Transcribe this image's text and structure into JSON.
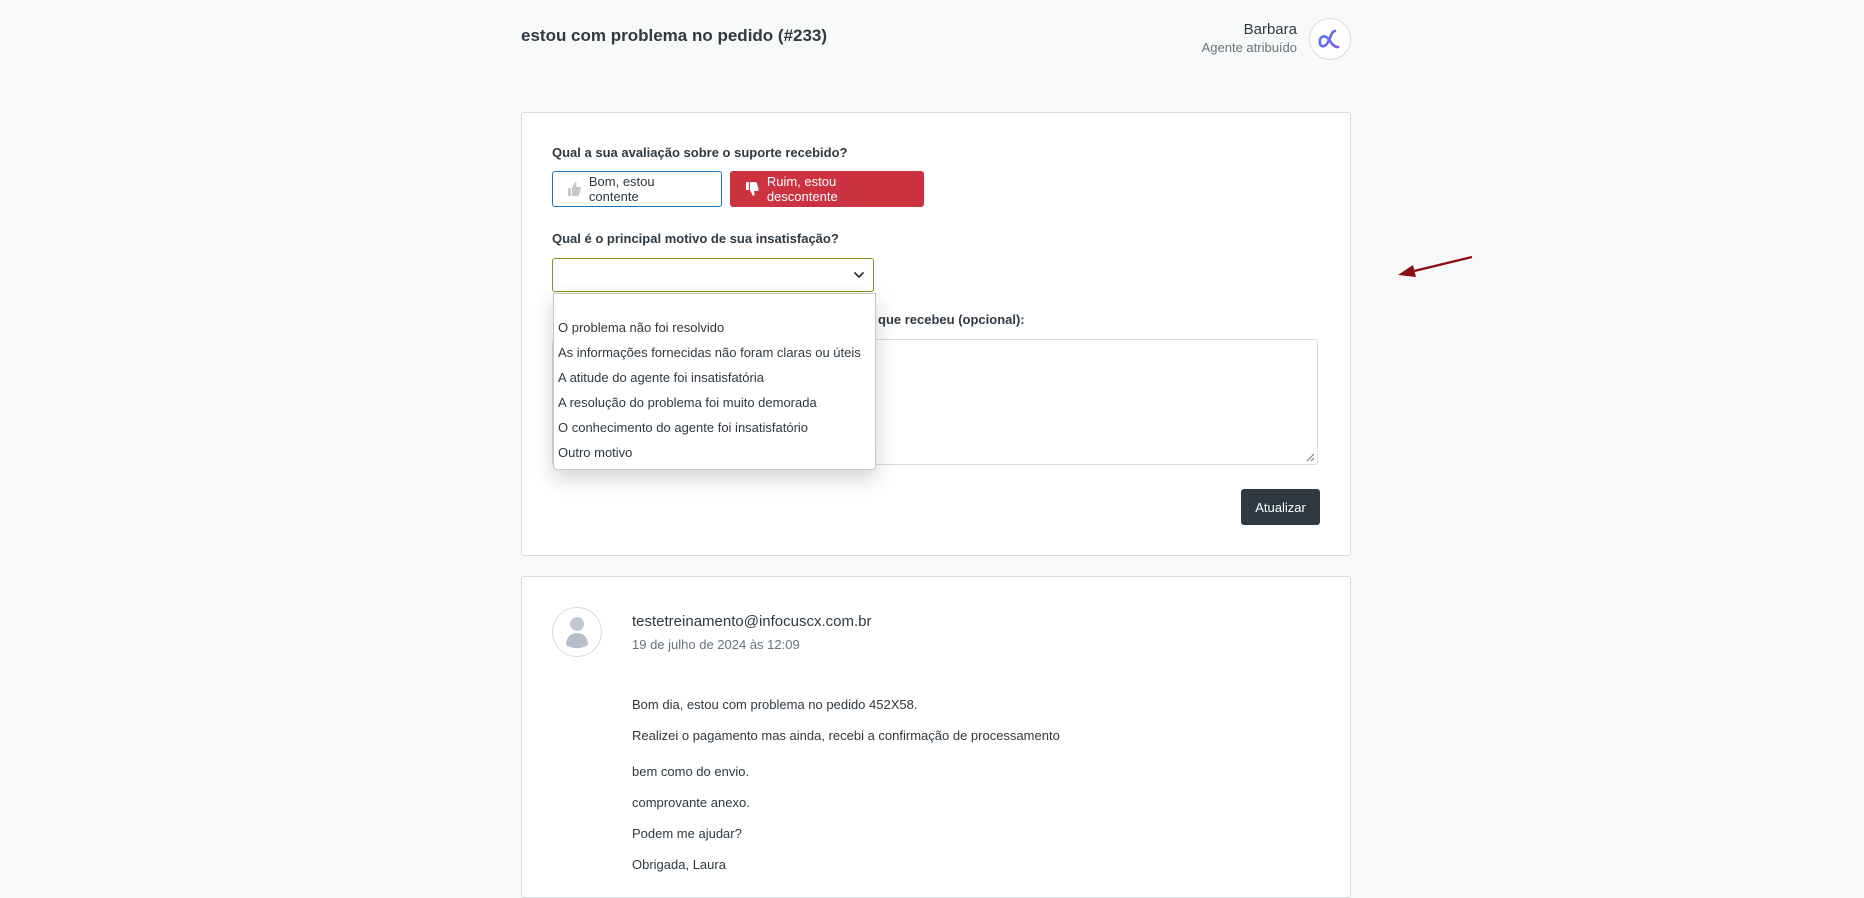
{
  "header": {
    "title": "estou com problema no pedido (#233)",
    "agent_name": "Barbara",
    "agent_role": "Agente atribuído",
    "brand_color": "#5c6fe8"
  },
  "rating": {
    "question": "Qual a sua avaliação sobre o suporte recebido?",
    "good_label": "Bom, estou contente",
    "bad_label": "Ruim, estou descontente",
    "selected": "bad",
    "bad_color": "#cc3340"
  },
  "reason": {
    "question": "Qual é o principal motivo de sua insatisfação?",
    "selected_value": "",
    "options": [
      "",
      "O problema não foi resolvido",
      "As informações fornecidas não foram claras ou úteis",
      "A atitude do agente foi insatisfatória",
      "A resolução do problema foi muito demorada",
      "O conhecimento do agente foi insatisfatório",
      "Outro motivo"
    ]
  },
  "comment": {
    "label_visible_fragment": "que recebeu (opcional):",
    "value": ""
  },
  "update_button": {
    "label": "Atualizar"
  },
  "annotation": {
    "arrow_color": "#8b0f12"
  },
  "thread": {
    "author": "testetreinamento@infocuscx.com.br",
    "date": "19 de julho de 2024 às 12:09",
    "lines": [
      "Bom dia, estou com problema no pedido 452X58.",
      "Realizei o pagamento mas ainda, recebi a confirmação de processamento",
      "bem como do envio.",
      "comprovante anexo.",
      "Podem me ajudar?",
      "Obrigada, Laura"
    ]
  }
}
